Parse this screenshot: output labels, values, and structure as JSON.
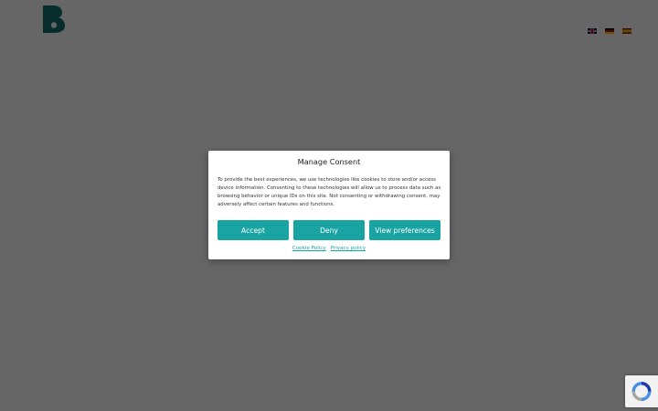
{
  "colors": {
    "brand": "#0f6e6e",
    "accent": "#1aa3a3",
    "overlay": "#4d4d4d"
  },
  "header": {
    "logo_icon": "brand-logo-b-icon",
    "languages": [
      {
        "code": "en",
        "icon": "flag-uk-icon"
      },
      {
        "code": "de",
        "icon": "flag-germany-icon"
      },
      {
        "code": "es",
        "icon": "flag-spain-icon"
      }
    ]
  },
  "consent": {
    "title": "Manage Consent",
    "body": "To provide the best experiences, we use technologies like cookies to store and/or access device information. Consenting to these technologies will allow us to process data such as browsing behavior or unique IDs on this site. Not consenting or withdrawing consent, may adversely affect certain features and functions.",
    "buttons": {
      "accept": "Accept",
      "deny": "Deny",
      "preferences": "View preferences"
    },
    "links": {
      "cookie_policy": "Cookie Policy",
      "privacy_policy": "Privacy policy"
    }
  },
  "recaptcha": {
    "icon": "recaptcha-icon"
  }
}
